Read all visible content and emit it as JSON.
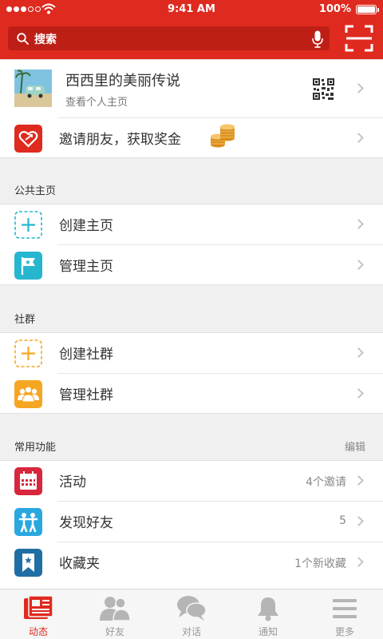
{
  "status_bar": {
    "time": "9:41 AM",
    "battery": "100%"
  },
  "search": {
    "placeholder": "搜索"
  },
  "profile": {
    "name": "西西里的美丽传说",
    "subtitle": "查看个人主页"
  },
  "invite": {
    "label": "邀请朋友，获取奖金"
  },
  "public_pages": {
    "title": "公共主页",
    "items": [
      {
        "label": "创建主页",
        "icon": "plus-icon"
      },
      {
        "label": "管理主页",
        "icon": "flag-icon"
      }
    ]
  },
  "groups": {
    "title": "社群",
    "items": [
      {
        "label": "创建社群",
        "icon": "plus-icon"
      },
      {
        "label": "管理社群",
        "icon": "people-icon"
      }
    ]
  },
  "common": {
    "title": "常用功能",
    "edit": "编辑",
    "items": [
      {
        "label": "活动",
        "meta": "4个邀请",
        "icon": "calendar-icon"
      },
      {
        "label": "发现好友",
        "meta": "5",
        "icon": "friends-icon"
      },
      {
        "label": "收藏夹",
        "meta": "1个新收藏",
        "icon": "bookmark-icon"
      }
    ]
  },
  "tabs": [
    {
      "label": "动态",
      "icon": "feed-icon",
      "active": true
    },
    {
      "label": "好友",
      "icon": "friends-icon"
    },
    {
      "label": "对话",
      "icon": "chat-icon"
    },
    {
      "label": "通知",
      "icon": "bell-icon"
    },
    {
      "label": "更多",
      "icon": "menu-icon"
    }
  ],
  "colors": {
    "brand_red": "#df2a1f",
    "teal": "#27b6cf",
    "orange": "#f5a623",
    "blue": "#1f6fa5"
  }
}
